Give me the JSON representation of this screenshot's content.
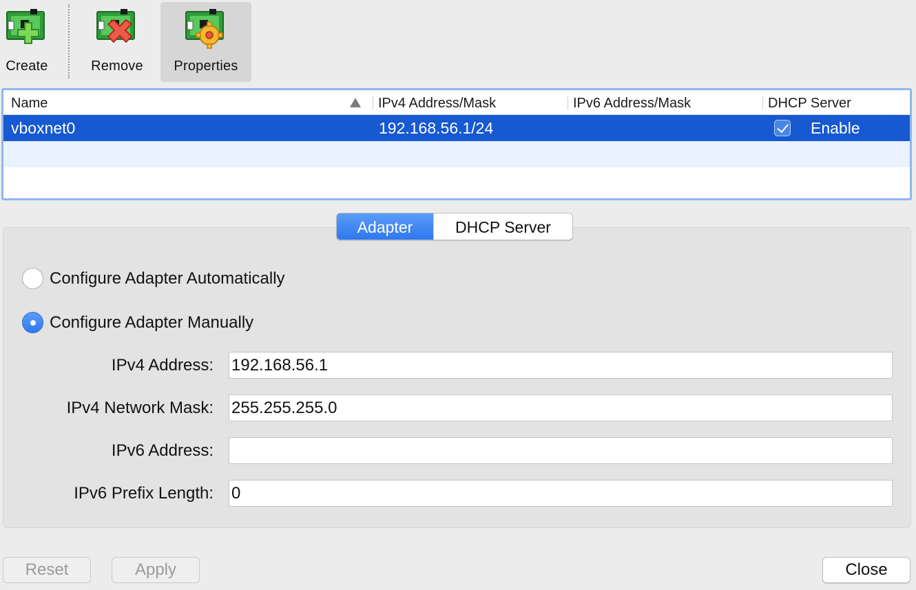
{
  "toolbar": {
    "create_label": "Create",
    "remove_label": "Remove",
    "properties_label": "Properties"
  },
  "table": {
    "columns": [
      "Name",
      "IPv4 Address/Mask",
      "IPv6 Address/Mask",
      "DHCP Server"
    ],
    "sort_column": "Name",
    "rows": [
      {
        "name": "vboxnet0",
        "ipv4": "192.168.56.1/24",
        "ipv6": "",
        "dhcp_enabled": true,
        "dhcp_label": "Enable"
      }
    ]
  },
  "tabs": {
    "adapter": "Adapter",
    "dhcp": "DHCP Server",
    "active": "Adapter"
  },
  "adapter": {
    "auto_label": "Configure Adapter Automatically",
    "manual_label": "Configure Adapter Manually",
    "selected_mode": "manual",
    "fields": {
      "ipv4_address_label": "IPv4 Address:",
      "ipv4_address_value": "192.168.56.1",
      "ipv4_mask_label": "IPv4 Network Mask:",
      "ipv4_mask_value": "255.255.255.0",
      "ipv6_address_label": "IPv6 Address:",
      "ipv6_address_value": "",
      "ipv6_prefix_label": "IPv6 Prefix Length:",
      "ipv6_prefix_value": "0"
    }
  },
  "buttons": {
    "reset": "Reset",
    "apply": "Apply",
    "close": "Close"
  },
  "colors": {
    "selection": "#1659d0",
    "accent": "#2f78ef",
    "list_border": "#8fb7f0"
  }
}
